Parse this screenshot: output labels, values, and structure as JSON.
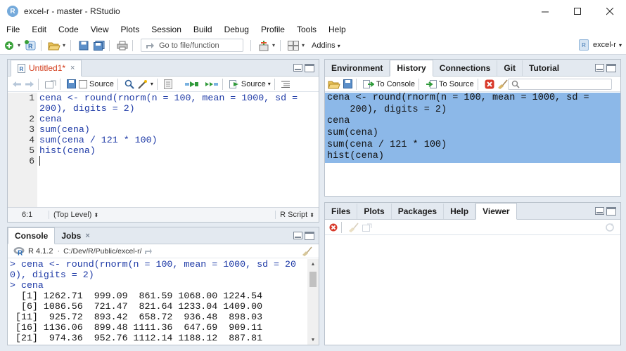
{
  "window": {
    "title": "excel-r - master - RStudio",
    "app_icon_letter": "R"
  },
  "menu": [
    "File",
    "Edit",
    "Code",
    "View",
    "Plots",
    "Session",
    "Build",
    "Debug",
    "Profile",
    "Tools",
    "Help"
  ],
  "toolbar": {
    "goto_placeholder": "Go to file/function",
    "addins_label": "Addins",
    "project_name": "excel-r"
  },
  "editor": {
    "tab_label": "Untitled1*",
    "source_on_save_label": "Source",
    "source_button_label": "Source",
    "line_numbers": [
      "1",
      "",
      "2",
      "3",
      "4",
      "5",
      "6"
    ],
    "code_lines": [
      "cena <- round(rnorm(n = 100, mean = 1000, sd =",
      "200), digits = 2)",
      "cena",
      "sum(cena)",
      "sum(cena / 121 * 100)",
      "hist(cena)",
      ""
    ],
    "status": {
      "position": "6:1",
      "scope": "(Top Level)",
      "filetype": "R Script"
    }
  },
  "env_pane": {
    "tabs": [
      "Environment",
      "History",
      "Connections",
      "Git",
      "Tutorial"
    ],
    "active_tab": "History",
    "to_console_label": "To Console",
    "to_source_label": "To Source",
    "history_lines": [
      "cena <- round(rnorm(n = 100, mean = 1000, sd =",
      "    200), digits = 2)",
      "cena",
      "sum(cena)",
      "sum(cena / 121 * 100)",
      "hist(cena)"
    ]
  },
  "files_pane": {
    "tabs": [
      "Files",
      "Plots",
      "Packages",
      "Help",
      "Viewer"
    ],
    "active_tab": "Viewer"
  },
  "console": {
    "tabs": [
      "Console",
      "Jobs"
    ],
    "r_version": "R 4.1.2",
    "working_dir": "C:/Dev/R/Public/excel-r/",
    "lines": [
      {
        "kind": "in",
        "text": "> cena <- round(rnorm(n = 100, mean = 1000, sd = 20"
      },
      {
        "kind": "in",
        "text": "0), digits = 2)"
      },
      {
        "kind": "in",
        "text": "> cena"
      },
      {
        "kind": "out",
        "text": "  [1] 1262.71  999.09  861.59 1068.00 1224.54"
      },
      {
        "kind": "out",
        "text": "  [6] 1086.56  721.47  821.64 1233.04 1409.00"
      },
      {
        "kind": "out",
        "text": " [11]  925.72  893.42  658.72  936.48  898.03"
      },
      {
        "kind": "out",
        "text": " [16] 1136.06  899.48 1111.36  647.69  909.11"
      },
      {
        "kind": "out",
        "text": " [21]  974.36  952.76 1112.14 1188.12  887.81"
      }
    ]
  },
  "colors": {
    "accent": "#75aadb",
    "selection": "#8cb8e8",
    "code_blue": "#1d39a6",
    "pane_bg": "#e5ebf2"
  }
}
